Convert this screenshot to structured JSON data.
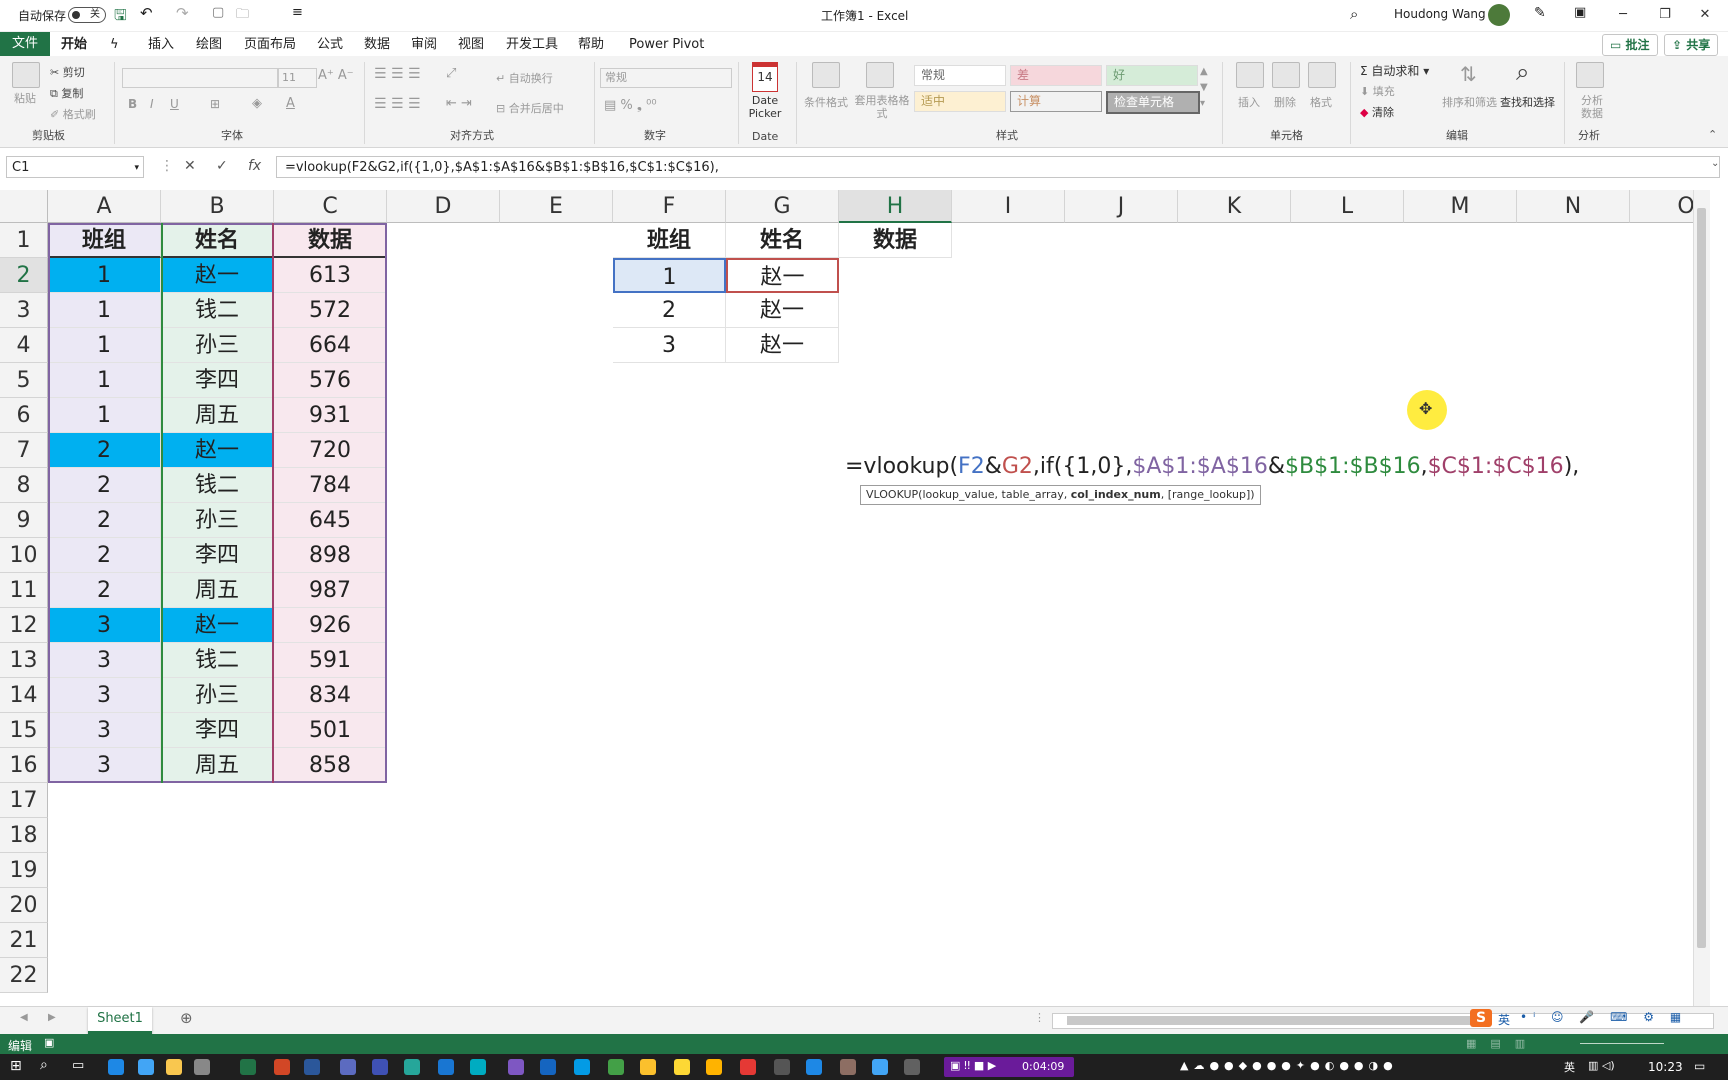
{
  "titlebar": {
    "autosave_label": "自动保存",
    "autosave_state": "关",
    "title": "工作簿1  -  Excel",
    "user": "Houdong Wang"
  },
  "tabs": [
    "开始",
    "插入",
    "绘图",
    "页面布局",
    "公式",
    "数据",
    "审阅",
    "视图",
    "开发工具",
    "帮助",
    "Power Pivot"
  ],
  "file_tab": "文件",
  "tab_buttons": {
    "comment": "批注",
    "share": "共享"
  },
  "ribbon": {
    "clipboard": {
      "paste": "粘贴",
      "cut": "剪切",
      "copy": "复制",
      "format_painter": "格式刷",
      "group": "剪贴板"
    },
    "font": {
      "font_size": "11",
      "group": "字体"
    },
    "alignment": {
      "wrap": "自动换行",
      "merge": "合并后居中",
      "group": "对齐方式"
    },
    "number": {
      "format": "常规",
      "group": "数字"
    },
    "date": {
      "label": "Date Picker",
      "day": "14",
      "group": "Date"
    },
    "styles": {
      "conditional": "条件格式",
      "table": "套用表格格式",
      "s1": "常规",
      "s2": "差",
      "s3": "好",
      "s4": "适中",
      "s5": "计算",
      "s6": "检查单元格",
      "group": "样式"
    },
    "cells": {
      "insert": "插入",
      "delete": "删除",
      "format": "格式",
      "group": "单元格"
    },
    "editing": {
      "autosum": "自动求和",
      "fill": "填充",
      "clear": "清除",
      "sort": "排序和筛选",
      "find": "查找和选择",
      "group": "编辑"
    },
    "analysis": {
      "analyze": "分析数据",
      "group": "分析"
    }
  },
  "formula_bar": {
    "name_box": "C1",
    "formula": "=vlookup(F2&G2,if({1,0},$A$1:$A$16&$B$1:$B$16,$C$1:$C$16),"
  },
  "columns": [
    "A",
    "B",
    "C",
    "D",
    "E",
    "F",
    "G",
    "H",
    "I",
    "J",
    "K",
    "L",
    "M",
    "N",
    "O"
  ],
  "rows": [
    "1",
    "2",
    "3",
    "4",
    "5",
    "6",
    "7",
    "8",
    "9",
    "10",
    "11",
    "12",
    "13",
    "14",
    "15",
    "16",
    "17",
    "18",
    "19",
    "20",
    "21",
    "22"
  ],
  "table_left": {
    "headers": [
      "班组",
      "姓名",
      "数据"
    ],
    "rows": [
      [
        "1",
        "赵一",
        "613"
      ],
      [
        "1",
        "钱二",
        "572"
      ],
      [
        "1",
        "孙三",
        "664"
      ],
      [
        "1",
        "李四",
        "576"
      ],
      [
        "1",
        "周五",
        "931"
      ],
      [
        "2",
        "赵一",
        "720"
      ],
      [
        "2",
        "钱二",
        "784"
      ],
      [
        "2",
        "孙三",
        "645"
      ],
      [
        "2",
        "李四",
        "898"
      ],
      [
        "2",
        "周五",
        "987"
      ],
      [
        "3",
        "赵一",
        "926"
      ],
      [
        "3",
        "钱二",
        "591"
      ],
      [
        "3",
        "孙三",
        "834"
      ],
      [
        "3",
        "李四",
        "501"
      ],
      [
        "3",
        "周五",
        "858"
      ]
    ]
  },
  "table_right": {
    "headers": [
      "班组",
      "姓名",
      "数据"
    ],
    "rows": [
      [
        "1",
        "赵一"
      ],
      [
        "2",
        "赵一"
      ],
      [
        "3",
        "赵一"
      ]
    ]
  },
  "edit": {
    "p1": "=vlookup(",
    "p2": "F2",
    "p3": "&",
    "p4": "G2",
    "p5": ",if({1,0},",
    "p6": "$A$1:$A$16",
    "p7": "&",
    "p8": "$B$1:$B$16",
    "p9": ",",
    "p10": "$C$1:$C$16",
    "p11": "),",
    "tooltip_a": "VLOOKUP(lookup_value, table_array, ",
    "tooltip_b": "col_index_num",
    "tooltip_c": ", [range_lookup])"
  },
  "colors": {
    "excel_green": "#217346",
    "highlight_blue": "#00b0f0",
    "col_a": "#ebe8f5",
    "col_b": "#e4f2ea",
    "col_c": "#f8e8ee",
    "ref_blue": "#4472c4",
    "ref_red": "#c0504d",
    "ref_purple": "#8064a2",
    "ref_green": "#2e8b3e",
    "ref_magenta": "#a0406a"
  },
  "sheet": {
    "name": "Sheet1"
  },
  "status": {
    "mode": "编辑"
  },
  "taskbar": {
    "recording": "0:04:09",
    "time": "10:23",
    "ime": "英"
  }
}
